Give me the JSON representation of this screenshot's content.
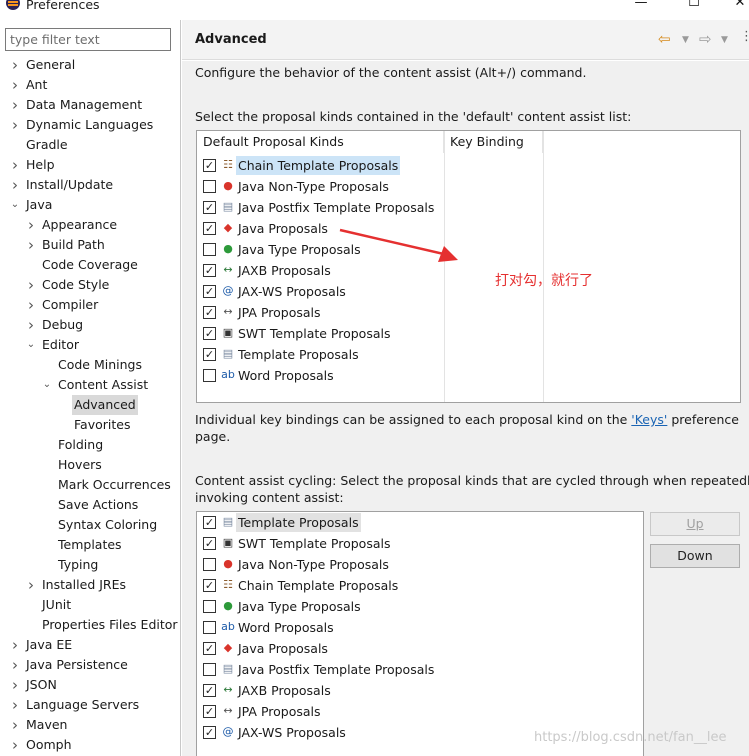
{
  "window": {
    "title": "Preferences"
  },
  "filter": {
    "placeholder": "type filter text"
  },
  "tree": [
    {
      "label": "General",
      "level": 0,
      "arrow": "right"
    },
    {
      "label": "Ant",
      "level": 0,
      "arrow": "right"
    },
    {
      "label": "Data Management",
      "level": 0,
      "arrow": "right"
    },
    {
      "label": "Dynamic Languages",
      "level": 0,
      "arrow": "right"
    },
    {
      "label": "Gradle",
      "level": 0,
      "arrow": ""
    },
    {
      "label": "Help",
      "level": 0,
      "arrow": "right"
    },
    {
      "label": "Install/Update",
      "level": 0,
      "arrow": "right"
    },
    {
      "label": "Java",
      "level": 0,
      "arrow": "down"
    },
    {
      "label": "Appearance",
      "level": 1,
      "arrow": "right"
    },
    {
      "label": "Build Path",
      "level": 1,
      "arrow": "right"
    },
    {
      "label": "Code Coverage",
      "level": 1,
      "arrow": ""
    },
    {
      "label": "Code Style",
      "level": 1,
      "arrow": "right"
    },
    {
      "label": "Compiler",
      "level": 1,
      "arrow": "right"
    },
    {
      "label": "Debug",
      "level": 1,
      "arrow": "right"
    },
    {
      "label": "Editor",
      "level": 1,
      "arrow": "down"
    },
    {
      "label": "Code Minings",
      "level": 2,
      "arrow": ""
    },
    {
      "label": "Content Assist",
      "level": 2,
      "arrow": "down"
    },
    {
      "label": "Advanced",
      "level": 3,
      "arrow": "",
      "selected": true
    },
    {
      "label": "Favorites",
      "level": 3,
      "arrow": ""
    },
    {
      "label": "Folding",
      "level": 2,
      "arrow": ""
    },
    {
      "label": "Hovers",
      "level": 2,
      "arrow": ""
    },
    {
      "label": "Mark Occurrences",
      "level": 2,
      "arrow": ""
    },
    {
      "label": "Save Actions",
      "level": 2,
      "arrow": ""
    },
    {
      "label": "Syntax Coloring",
      "level": 2,
      "arrow": ""
    },
    {
      "label": "Templates",
      "level": 2,
      "arrow": ""
    },
    {
      "label": "Typing",
      "level": 2,
      "arrow": ""
    },
    {
      "label": "Installed JREs",
      "level": 1,
      "arrow": "right"
    },
    {
      "label": "JUnit",
      "level": 1,
      "arrow": ""
    },
    {
      "label": "Properties Files Editor",
      "level": 1,
      "arrow": ""
    },
    {
      "label": "Java EE",
      "level": 0,
      "arrow": "right"
    },
    {
      "label": "Java Persistence",
      "level": 0,
      "arrow": "right"
    },
    {
      "label": "JSON",
      "level": 0,
      "arrow": "right"
    },
    {
      "label": "Language Servers",
      "level": 0,
      "arrow": "right"
    },
    {
      "label": "Maven",
      "level": 0,
      "arrow": "right"
    },
    {
      "label": "Oomph",
      "level": 0,
      "arrow": "right"
    }
  ],
  "page": {
    "title": "Advanced",
    "description": "Configure the behavior of the content assist (Alt+/) command.",
    "default_list_label": "Select the proposal kinds contained in the 'default' content assist list:",
    "col_kinds": "Default Proposal Kinds",
    "col_binding": "Key Binding",
    "keys_text_before": "Individual key bindings can be assigned to each proposal kind on the ",
    "keys_link": "'Keys'",
    "keys_text_after": " preference",
    "keys_text_line2": "page.",
    "cycling_line1": "Content assist cycling: Select the proposal kinds that are cycled through when repeatedly",
    "cycling_line2": "invoking content assist:",
    "up_button": "Up",
    "down_button": "Down"
  },
  "default_kinds": [
    {
      "label": "Chain Template Proposals",
      "checked": true,
      "icon": "chain-template-icon"
    },
    {
      "label": "Java Non-Type Proposals",
      "checked": false,
      "icon": "java-non-type-icon"
    },
    {
      "label": "Java Postfix Template Proposals",
      "checked": true,
      "icon": "template-icon"
    },
    {
      "label": "Java Proposals",
      "checked": true,
      "icon": "java-proposals-icon"
    },
    {
      "label": "Java Type Proposals",
      "checked": false,
      "icon": "java-type-icon"
    },
    {
      "label": "JAXB Proposals",
      "checked": true,
      "icon": "jaxb-icon"
    },
    {
      "label": "JAX-WS Proposals",
      "checked": true,
      "icon": "at-icon"
    },
    {
      "label": "JPA Proposals",
      "checked": true,
      "icon": "jpa-icon"
    },
    {
      "label": "SWT Template Proposals",
      "checked": true,
      "icon": "swt-icon"
    },
    {
      "label": "Template Proposals",
      "checked": true,
      "icon": "template-icon"
    },
    {
      "label": "Word Proposals",
      "checked": false,
      "icon": "word-icon"
    }
  ],
  "cycling_kinds": [
    {
      "label": "Template Proposals",
      "checked": true,
      "icon": "template-icon"
    },
    {
      "label": "SWT Template Proposals",
      "checked": true,
      "icon": "swt-icon"
    },
    {
      "label": "Java Non-Type Proposals",
      "checked": false,
      "icon": "java-non-type-icon"
    },
    {
      "label": "Chain Template Proposals",
      "checked": true,
      "icon": "chain-template-icon"
    },
    {
      "label": "Java Type Proposals",
      "checked": false,
      "icon": "java-type-icon"
    },
    {
      "label": "Word Proposals",
      "checked": false,
      "icon": "word-icon"
    },
    {
      "label": "Java Proposals",
      "checked": true,
      "icon": "java-proposals-icon"
    },
    {
      "label": "Java Postfix Template Proposals",
      "checked": false,
      "icon": "template-icon"
    },
    {
      "label": "JAXB Proposals",
      "checked": true,
      "icon": "jaxb-icon"
    },
    {
      "label": "JPA Proposals",
      "checked": true,
      "icon": "jpa-icon"
    },
    {
      "label": "JAX-WS Proposals",
      "checked": true,
      "icon": "at-icon"
    }
  ],
  "annotation": {
    "text": "打对勾，就行了",
    "color": "#e53030"
  },
  "watermark": "https://blog.csdn.net/fan__lee"
}
